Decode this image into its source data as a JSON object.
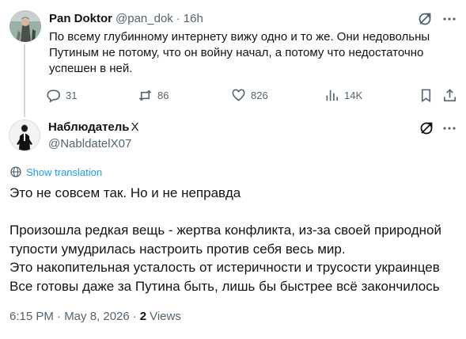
{
  "parent_post": {
    "author_name": "Pan Doktor",
    "author_handle": "@pan_dok",
    "separator": "·",
    "time": "16h",
    "text": "По всему глубинному интернету вижу одно и то же. Они недовольны Путиным не потому, что он войну начал, а потому что недостаточно успешен в ней.",
    "actions": {
      "replies": "31",
      "reposts": "86",
      "likes": "826",
      "views": "14K"
    }
  },
  "reply_post": {
    "author_name": "Наблюдатель",
    "author_badge": "X",
    "author_handle": "@NabldatelX07",
    "translate_label": "Show translation",
    "lines": [
      "Это не совсем так. Но и не неправда",
      "",
      "Произошла редкая вещь - жертва конфликта, из-за своей природной тупости умудрилась настроить против себя весь мир.",
      "Это накопительная усталость от истеричности и трусости украинцев",
      "Все готовы даже за Путина быть, лишь бы быстрее всё закончилось"
    ],
    "timestamp": "6:15 PM · May 8, 2026",
    "meta_separator": "·",
    "views_count": "2",
    "views_label": "Views"
  },
  "icons": {
    "grok": "grok-icon",
    "more": "more-icon",
    "reply": "reply-icon",
    "repost": "repost-icon",
    "like": "heart-icon",
    "views": "views-icon",
    "bookmark": "bookmark-icon",
    "share": "share-icon",
    "translate": "globe-icon"
  },
  "colors": {
    "text": "#0f1419",
    "secondary": "#536471",
    "link": "#1d9bf0",
    "thread_line": "#cfd9de"
  }
}
